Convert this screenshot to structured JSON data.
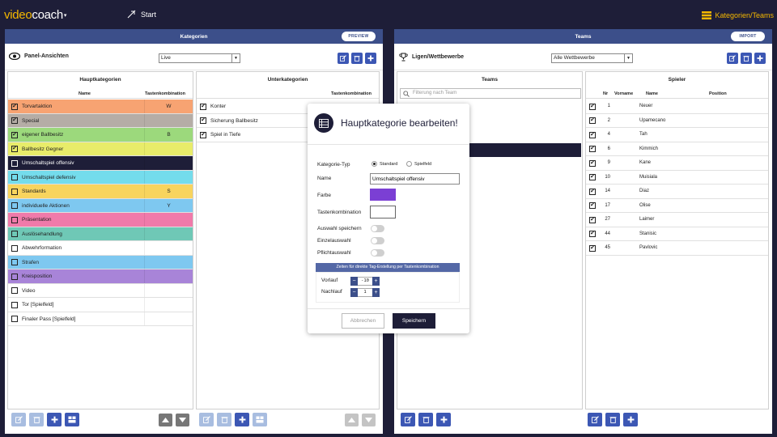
{
  "app": {
    "logo_video": "video",
    "logo_coach": "coach",
    "start": "Start",
    "top_right": "Kategorien/Teams"
  },
  "kategorien": {
    "title": "Kategorien",
    "pill": "PREVIEW",
    "panel_label": "Panel-Ansichten",
    "panel_select": "Live",
    "haupt_title": "Hauptkategorien",
    "haupt_col_name": "Name",
    "haupt_col_key": "Tastenkombination",
    "unter_title": "Unterkategorien",
    "unter_col_key": "Tastenkombination",
    "haupt_rows": [
      {
        "name": "Torvartaktion",
        "key": "W",
        "color": "#f7a372",
        "checked": true
      },
      {
        "name": "Special",
        "key": "",
        "color": "#b5ada6",
        "checked": true
      },
      {
        "name": "eigener Ballbesitz",
        "key": "B",
        "color": "#9cd97c",
        "checked": true
      },
      {
        "name": "Ballbesitz Gegner",
        "key": "",
        "color": "#e8ec6a",
        "checked": true
      },
      {
        "name": "Umschaltspiel offensiv",
        "key": "",
        "color": "#1e1e38",
        "checked": false
      },
      {
        "name": "Umschaltspiel defensiv",
        "key": "",
        "color": "#74dcec",
        "checked": false
      },
      {
        "name": "Standards",
        "key": "S",
        "color": "#f8d45e",
        "checked": false
      },
      {
        "name": "individuelle Aktionen",
        "key": "Y",
        "color": "#7ec8f0",
        "checked": false
      },
      {
        "name": "Präsentation",
        "key": "",
        "color": "#f07aaa",
        "checked": false
      },
      {
        "name": "Auslösehandlung",
        "key": "",
        "color": "#6fc8b6",
        "checked": false
      },
      {
        "name": "Abwehrformation",
        "key": "",
        "color": "#ffffff",
        "checked": false
      },
      {
        "name": "Strafen",
        "key": "",
        "color": "#7ec8f0",
        "checked": false
      },
      {
        "name": "Kreisposition",
        "key": "",
        "color": "#a884d8",
        "checked": false
      },
      {
        "name": "Video",
        "key": "",
        "color": "#ffffff",
        "checked": false
      },
      {
        "name": "Tor  [Spielfeld]",
        "key": "",
        "color": "#ffffff",
        "checked": false
      },
      {
        "name": "Finaler Pass  [Spielfeld]",
        "key": "",
        "color": "#ffffff",
        "checked": false
      }
    ],
    "unter_rows": [
      {
        "name": "Konter"
      },
      {
        "name": "Sicherung Ballbesitz"
      },
      {
        "name": "Spiel in Tiefe"
      }
    ]
  },
  "teams": {
    "title": "Teams",
    "pill": "IMPORT",
    "league_label": "Ligen/Wettbewerbe",
    "league_select": "Alle Wettbewerbe",
    "teams_title": "Teams",
    "search_placeholder": "Filterung nach Team",
    "spieler_title": "Spieler",
    "col_nr": "Nr",
    "col_vorname": "Vorname",
    "col_name": "Name",
    "col_position": "Position",
    "players": [
      {
        "nr": "1",
        "name": "Neuer"
      },
      {
        "nr": "2",
        "name": "Upamecano"
      },
      {
        "nr": "4",
        "name": "Tah"
      },
      {
        "nr": "6",
        "name": "Kimmich"
      },
      {
        "nr": "9",
        "name": "Kane"
      },
      {
        "nr": "10",
        "name": "Muisiala"
      },
      {
        "nr": "14",
        "name": "Diaz"
      },
      {
        "nr": "17",
        "name": "Olise"
      },
      {
        "nr": "27",
        "name": "Laimer"
      },
      {
        "nr": "44",
        "name": "Stanisic"
      },
      {
        "nr": "45",
        "name": "Pavlovic"
      }
    ]
  },
  "modal": {
    "title": "Hauptkategorie bearbeiten!",
    "type_label": "Kategorie-Typ",
    "type_standard": "Standard",
    "type_spielfeld": "Spielfeld",
    "name_label": "Name",
    "name_value": "Umschaltspiel offensiv",
    "color_label": "Farbe",
    "color_value": "#7b3fd4",
    "key_label": "Tastenkombination",
    "auswahl_label": "Auswahl speichern",
    "einzel_label": "Einzelauswahl",
    "pflicht_label": "Pflichtauswahl",
    "zeiten_header": "Zeiten für direkte Tag-Erstellung per Tastenkombination",
    "vorlauf_label": "Vorlauf",
    "vorlauf_value": "-10",
    "nachlauf_label": "Nachlauf",
    "nachlauf_value": "1",
    "cancel": "Abbrechen",
    "save": "Speichern"
  }
}
